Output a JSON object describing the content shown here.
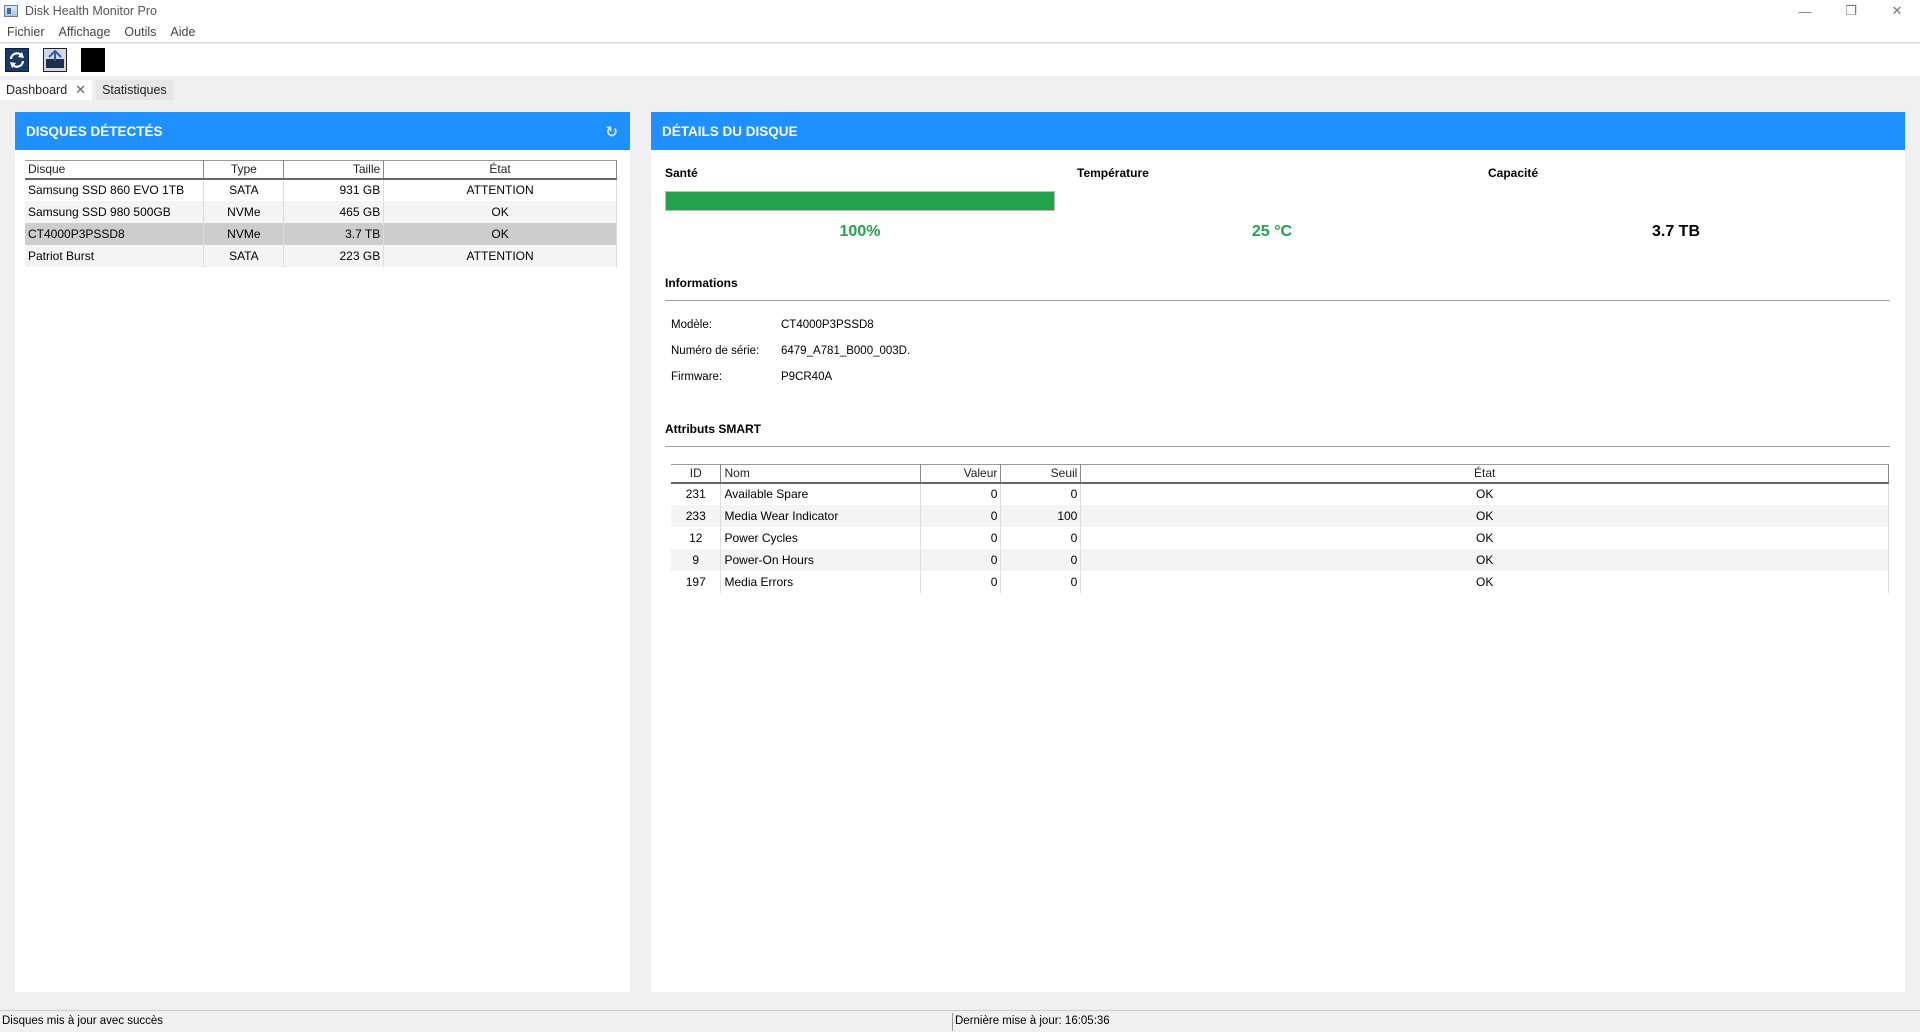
{
  "window": {
    "title": "Disk Health Monitor Pro",
    "minimize": "—",
    "maximize": "❐",
    "close": "✕"
  },
  "menu": [
    "Fichier",
    "Affichage",
    "Outils",
    "Aide"
  ],
  "tabs": {
    "active": "Dashboard",
    "close": "✕",
    "inactive": "Statistiques"
  },
  "left": {
    "header": "DISQUES DÉTECTÉS",
    "refresh_icon": "↻",
    "columns": [
      "Disque",
      "Type",
      "Taille",
      "État"
    ],
    "rows": [
      {
        "disk": "Samsung SSD 860 EVO 1TB",
        "type": "SATA",
        "size": "931 GB",
        "state": "ATTENTION"
      },
      {
        "disk": "Samsung SSD 980 500GB",
        "type": "NVMe",
        "size": "465 GB",
        "state": "OK"
      },
      {
        "disk": "CT4000P3PSSD8",
        "type": "NVMe",
        "size": "3.7 TB",
        "state": "OK"
      },
      {
        "disk": "Patriot Burst",
        "type": "SATA",
        "size": "223 GB",
        "state": "ATTENTION"
      }
    ],
    "selected_index": 2
  },
  "right": {
    "header": "DÉTAILS DU DISQUE",
    "health_label": "Santé",
    "health_value": "100%",
    "health_fraction": 1.0,
    "temp_label": "Température",
    "temp_value": "25 °C",
    "capacity_label": "Capacité",
    "capacity_value": "3.7 TB",
    "info_title": "Informations",
    "info": [
      {
        "k": "Modèle:",
        "v": "CT4000P3PSSD8"
      },
      {
        "k": "Numéro de série:",
        "v": "6479_A781_B000_003D."
      },
      {
        "k": "Firmware:",
        "v": "P9CR40A"
      }
    ],
    "smart_title": "Attributs SMART",
    "smart_columns": [
      "ID",
      "Nom",
      "Valeur",
      "Seuil",
      "État"
    ],
    "smart_rows": [
      {
        "id": "231",
        "name": "Available Spare",
        "value": "0",
        "threshold": "0",
        "state": "OK"
      },
      {
        "id": "233",
        "name": "Media Wear Indicator",
        "value": "0",
        "threshold": "100",
        "state": "OK"
      },
      {
        "id": "12",
        "name": "Power Cycles",
        "value": "0",
        "threshold": "0",
        "state": "OK"
      },
      {
        "id": "9",
        "name": "Power-On Hours",
        "value": "0",
        "threshold": "0",
        "state": "OK"
      },
      {
        "id": "197",
        "name": "Media Errors",
        "value": "0",
        "threshold": "0",
        "state": "OK"
      }
    ]
  },
  "status": {
    "left": "Disques mis à jour avec succès",
    "right": "Dernière mise à jour: 16:05:36"
  },
  "colors": {
    "accent": "#1e90ff",
    "good": "#22a24b",
    "health_text": "#1ea44b"
  }
}
